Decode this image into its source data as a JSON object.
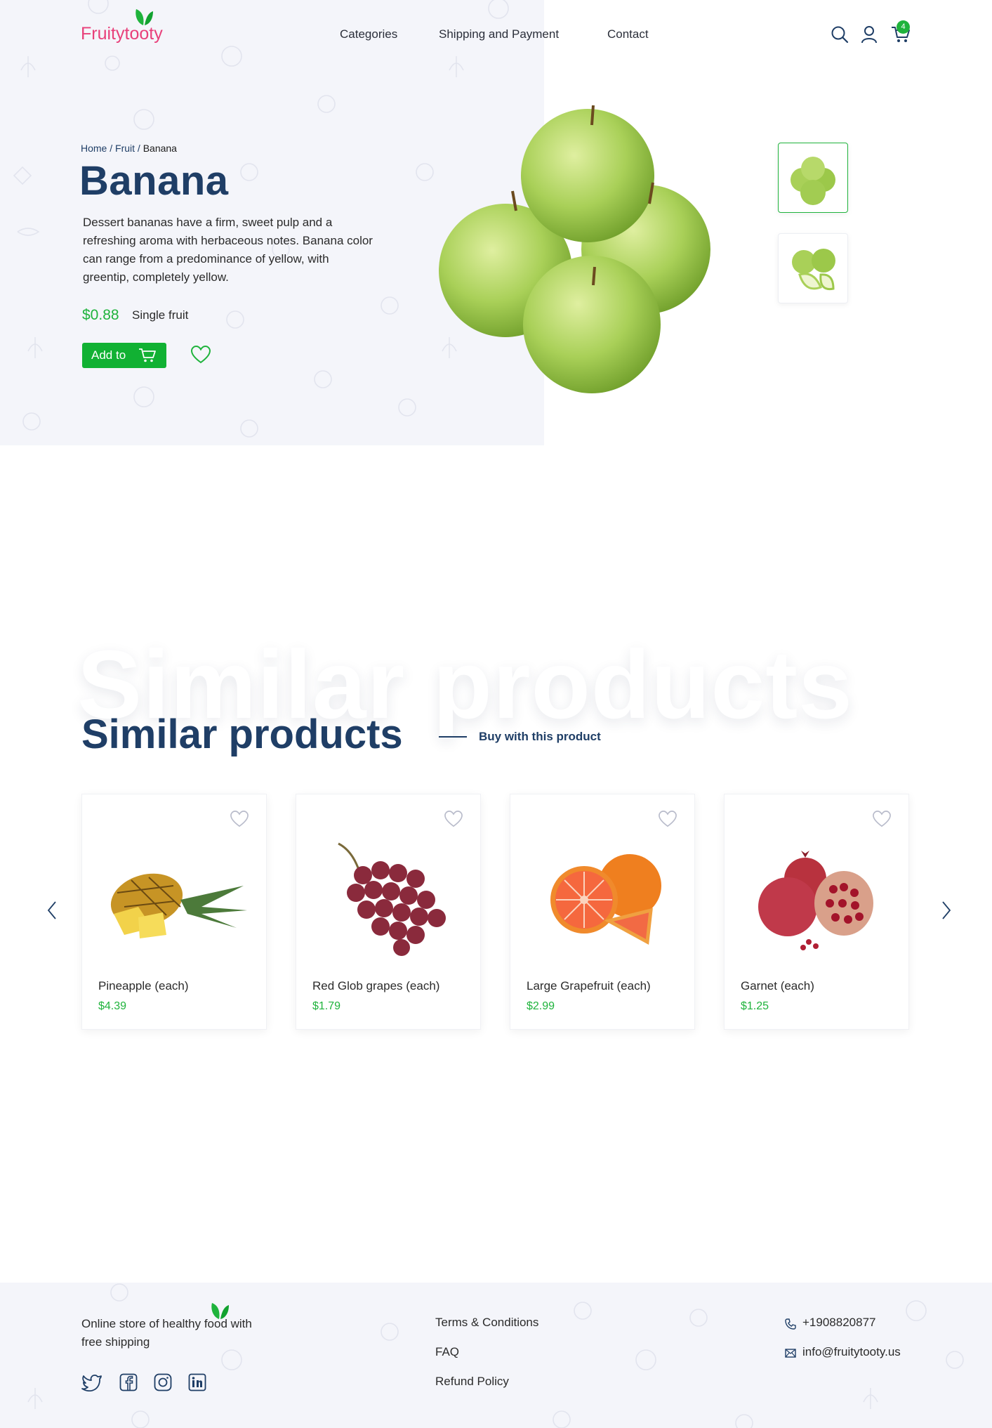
{
  "brand": {
    "logo": "Fruitytooty"
  },
  "nav": {
    "items": [
      "Categories",
      "Shipping and Payment",
      "Contact"
    ]
  },
  "header": {
    "cart_count": "4",
    "icons": [
      "search-icon",
      "user-icon",
      "cart-icon"
    ]
  },
  "breadcrumb": {
    "home": "Home",
    "category": "Fruit",
    "current": "Banana",
    "separator": "/"
  },
  "product": {
    "title": "Banana",
    "description": "Dessert bananas have a firm, sweet pulp and a refreshing aroma with herbaceous notes. Banana color can range from a predominance of yellow, with greentip, completely yellow.",
    "price": "$0.88",
    "unit": "Single fruit",
    "add_label": "Add to"
  },
  "similar": {
    "title": "Similar products",
    "ghost_title": "Similar products",
    "subtitle": "Buy with this product",
    "items": [
      {
        "name": "Pineapple (each)",
        "price": "$4.39"
      },
      {
        "name": "Red Glob grapes (each)",
        "price": "$1.79"
      },
      {
        "name": "Large Grapefruit (each)",
        "price": "$2.99"
      },
      {
        "name": "Garnet (each)",
        "price": "$1.25"
      }
    ]
  },
  "footer": {
    "tagline": "Online store of healthy food with free shipping",
    "links": [
      "Terms & Conditions",
      "FAQ",
      "Refund Policy"
    ],
    "phone": "+1908820877",
    "email": "info@fruitytooty.us",
    "social": [
      "twitter-icon",
      "facebook-icon",
      "instagram-icon",
      "linkedin-icon"
    ]
  },
  "colors": {
    "accent": "#1fb33c",
    "navy": "#1f3e66",
    "logo": "#e8407a",
    "panel": "#f4f5fa"
  }
}
